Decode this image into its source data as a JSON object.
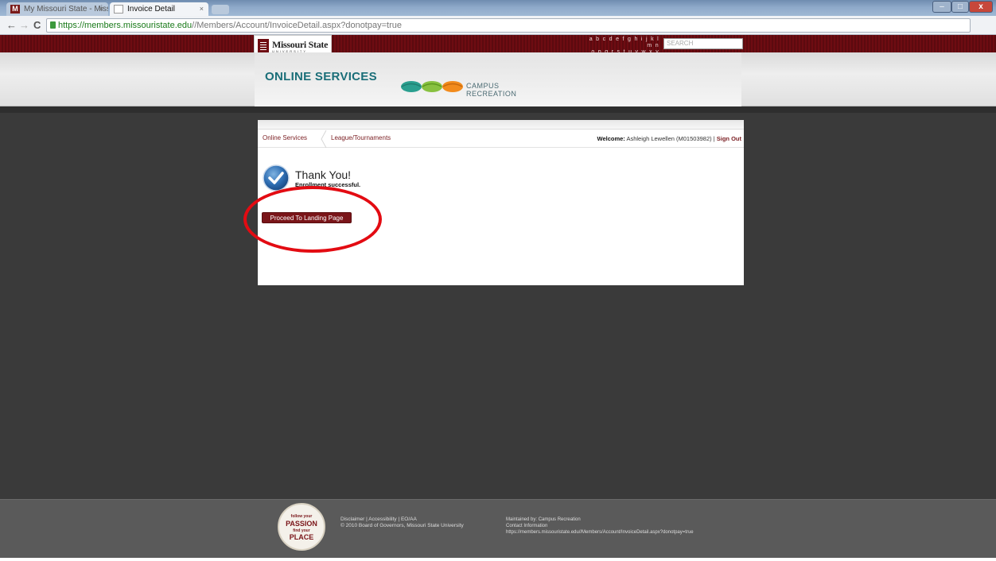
{
  "browser": {
    "tabs": [
      {
        "label": "My Missouri State - Missou",
        "favicon": "M"
      },
      {
        "label": "Invoice Detail"
      }
    ],
    "tab_close": "×",
    "window": {
      "min": "–",
      "max": "□",
      "close": "x"
    },
    "nav": {
      "back": "←",
      "forward": "→",
      "reload": "C"
    },
    "url": {
      "scheme": "https://",
      "host": "members.missouristate.edu",
      "path": "//Members/Account/InvoiceDetail.aspx?donotpay=true"
    },
    "star": "☆",
    "wrench": "🔧"
  },
  "header": {
    "logo_text": "Missouri State",
    "logo_sub": "UNIVERSITY",
    "az_line1": "a b c d e f g h i j k l m n",
    "az_line2": "o p q r s t u v w x y z",
    "search_placeholder": "SEARCH",
    "title": "ONLINE SERVICES",
    "rec_line1": "CAMPUS",
    "rec_line2": "RECREATION"
  },
  "panel": {
    "breadcrumbs": [
      "Online Services",
      "League/Tournaments"
    ],
    "welcome_label": "Welcome:",
    "welcome_user": " Ashleigh Lewellen  (M01503982)  |  ",
    "sign_out": "Sign Out",
    "thank_you": "Thank You!",
    "enroll_msg": "Enrollment successful.",
    "proceed_button": "Proceed To Landing Page"
  },
  "footer": {
    "badge": [
      "follow your",
      "PASSION",
      "find your",
      "PLACE"
    ],
    "links": "Disclaimer  |  Accessibility  |  EO/AA",
    "copyright": "© 2010 Board of Governors, Missouri State University",
    "maintained": "Maintained by: Campus Recreation",
    "contact": "Contact Information",
    "page_url": "https://members.missouristate.edu//Members/Account/InvoiceDetail.aspx?donotpay=true"
  },
  "colors": {
    "maroon": "#6e0c12",
    "teal": "#1a6e78",
    "annotation_red": "#e30b12"
  }
}
